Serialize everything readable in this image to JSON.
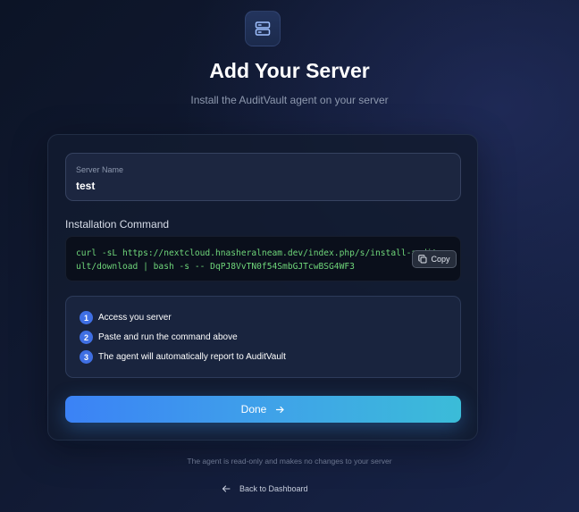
{
  "header": {
    "logo_icon": "server-icon",
    "title": "Add Your Server",
    "subtitle": "Install the AuditVault agent on your server"
  },
  "form": {
    "server_name_label": "Server Name",
    "server_name_value": "test"
  },
  "install": {
    "label": "Installation Command",
    "command": "curl -sL https://nextcloud.hnasheralneam.dev/index.php/s/install-auditvault/download | bash -s -- DqPJ8VvTN0f54SmbGJTcwBSG4WF3",
    "copy_label": "Copy",
    "copy_icon": "copy-icon"
  },
  "steps": [
    {
      "num": "1",
      "text": "Access you server"
    },
    {
      "num": "2",
      "text": "Paste and run the command above"
    },
    {
      "num": "3",
      "text": "The agent will automatically report to AuditVault"
    }
  ],
  "actions": {
    "done_label": "Done",
    "done_icon": "arrow-right-icon"
  },
  "footer": {
    "note": "The agent is read-only and makes no changes to your server",
    "back_label": "Back to Dashboard",
    "back_icon": "arrow-left-icon"
  },
  "colors": {
    "accent": "#3b82f6",
    "accent_end": "#3bbcd8",
    "code_text": "#6fd67a",
    "background": "#111a33"
  }
}
